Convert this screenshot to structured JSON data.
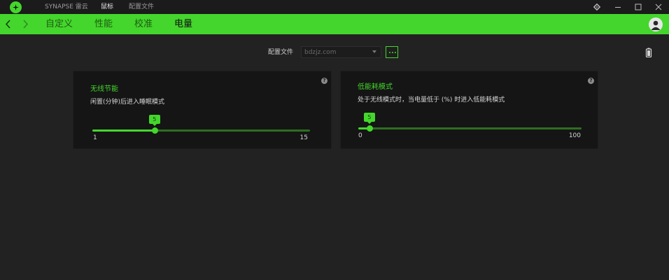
{
  "titlebar": {
    "app_name": "SYNAPSE 雷云",
    "tabs": [
      {
        "label": "鼠标",
        "active": true
      },
      {
        "label": "配置文件",
        "active": false
      }
    ],
    "controls": [
      "gear-icon",
      "minimize-icon",
      "maximize-icon",
      "close-icon"
    ]
  },
  "nav": {
    "tabs": [
      {
        "label": "自定义",
        "active": false
      },
      {
        "label": "性能",
        "active": false
      },
      {
        "label": "校准",
        "active": false
      },
      {
        "label": "电量",
        "active": true
      }
    ]
  },
  "profile": {
    "label": "配置文件",
    "selected": "bdzjz.com"
  },
  "cards": [
    {
      "title": "无线节能",
      "description": "闲置(分钟)后进入睡眠模式",
      "slider": {
        "min_label": "1",
        "max_label": "15",
        "min": 1,
        "max": 15,
        "value": 5,
        "value_label": "5"
      }
    },
    {
      "title": "低能耗模式",
      "description": "处于无线模式时，当电量低于 (%) 时进入低能耗模式",
      "slider": {
        "min_label": "0",
        "max_label": "100",
        "min": 0,
        "max": 100,
        "value": 5,
        "value_label": "5"
      }
    }
  ],
  "colors": {
    "accent": "#44d62c",
    "background": "#222222",
    "card": "#151515",
    "titlebar": "#1b1b1b"
  }
}
